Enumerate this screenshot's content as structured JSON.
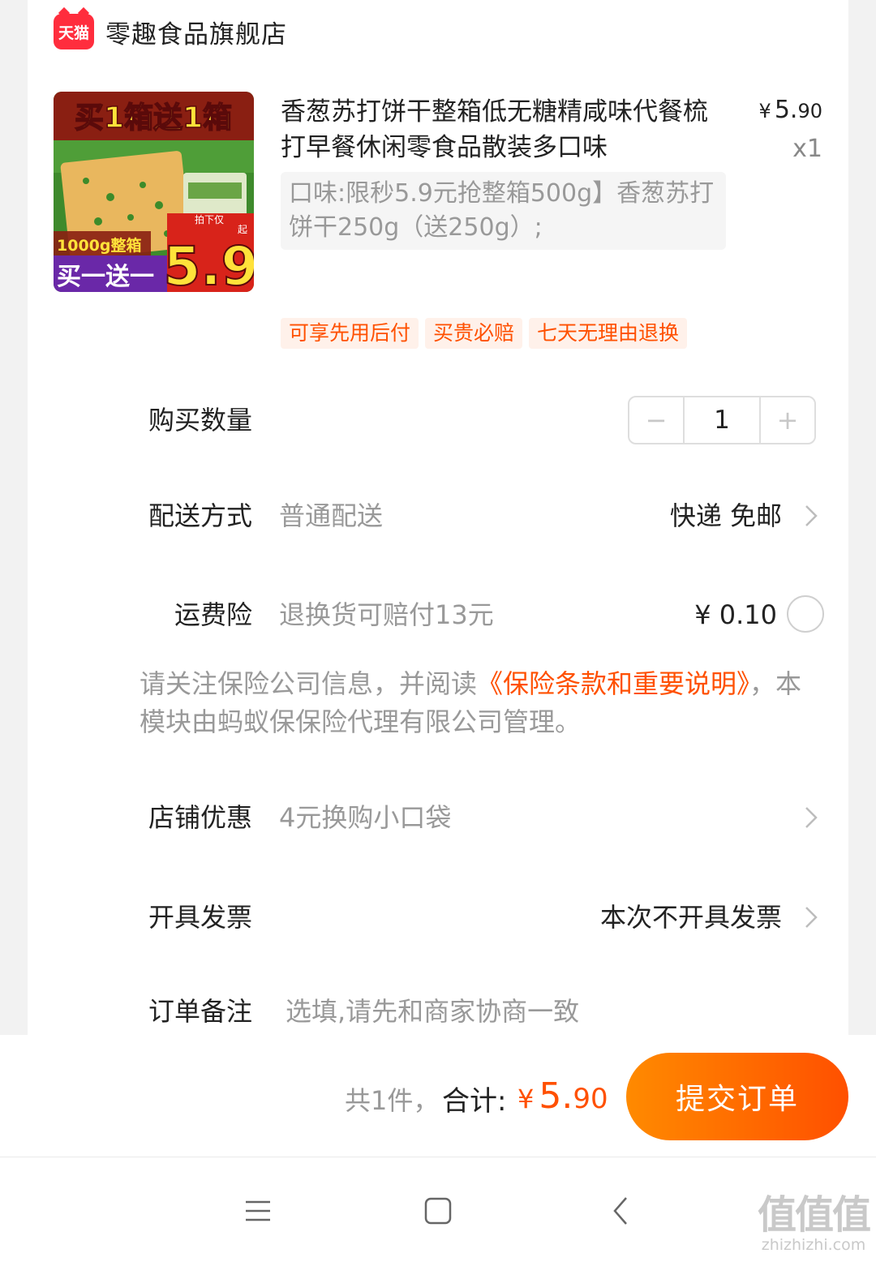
{
  "store": {
    "badge": "天猫",
    "name": "零趣食品旗舰店"
  },
  "product": {
    "title": "香葱苏打饼干整箱低无糖精咸味代餐梳打早餐休闲零食品散装多口味",
    "price_yen": "¥",
    "price_int": "5.",
    "price_dec": "90",
    "quantity": "x1",
    "sku": "口味:限秒5.9元抢整箱500g】香葱苏打饼干250g（送250g）;",
    "image": {
      "banner": "买1箱送1箱",
      "weight": "1000g整箱",
      "promo": "买一送一",
      "price_label": "拍下仅",
      "price_unit": "起",
      "price": "5.9"
    },
    "tags": [
      "可享先用后付",
      "买贵必赔",
      "七天无理由退换"
    ]
  },
  "quantity_row": {
    "label": "购买数量",
    "value": "1",
    "minus": "−",
    "plus": "+"
  },
  "delivery": {
    "label": "配送方式",
    "value": "普通配送",
    "right": "快递 免邮"
  },
  "insurance": {
    "label": "运费险",
    "value": "退换货可赔付13元",
    "price": "¥ 0.10",
    "note_prefix": "请关注保险公司信息，并阅读",
    "note_link": "《保险条款和重要说明》",
    "note_suffix": "，本模块由蚂蚁保保险代理有限公司管理。"
  },
  "store_discount": {
    "label": "店铺优惠",
    "value": "4元换购小口袋"
  },
  "invoice": {
    "label": "开具发票",
    "right": "本次不开具发票"
  },
  "remark": {
    "label": "订单备注",
    "placeholder": "选填,请先和商家协商一致"
  },
  "summary": {
    "count": "共1件，",
    "total_label": "合计:",
    "yen": "¥",
    "total_int": "5.",
    "total_dec": "90",
    "submit": "提交订单"
  },
  "watermark": {
    "logo": "值值值",
    "url": "zhizhizhi.com"
  },
  "colors": {
    "accent": "#ff5000",
    "tmall_red": "#ff2d3d"
  }
}
